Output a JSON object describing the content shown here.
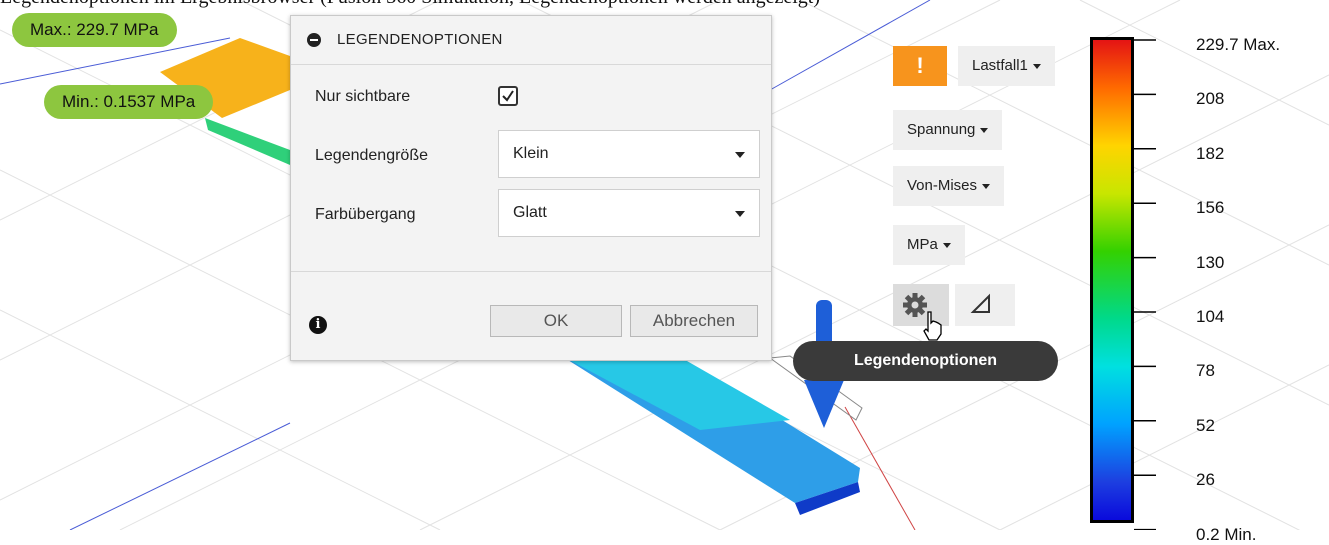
{
  "caption": "Legendenoptionen im Ergebnisbrowser (Fusion 360 Simulation, Legendenoptionen werden angezeigt)",
  "result_tags": {
    "max": "Max.: 229.7 MPa",
    "min": "Min.: 0.1537 MPa"
  },
  "dialog": {
    "title": "LEGENDENOPTIONEN",
    "rows": {
      "visible_only": {
        "label": "Nur sichtbare",
        "checked": true
      },
      "legend_size": {
        "label": "Legendengröße",
        "value": "Klein"
      },
      "color_transition": {
        "label": "Farbübergang",
        "value": "Glatt"
      }
    },
    "ok_label": "OK",
    "cancel_label": "Abbrechen"
  },
  "controls": {
    "warning": "!",
    "load_case": "Lastfall1",
    "result_type": "Spannung",
    "stress_type": "Von-Mises",
    "unit": "MPa",
    "tooltip": "Legendenoptionen"
  },
  "legend": {
    "ticks": [
      "229.7 Max.",
      "208",
      "182",
      "156",
      "130",
      "104",
      "78",
      "52",
      "26",
      "0.2 Min."
    ],
    "gradient_top_color": "#e41414",
    "gradient_bottom_color": "#0a0adc"
  },
  "colors": {
    "tag_green": "#8dc63f",
    "warning_orange": "#f7941d",
    "tooltip_bg": "#3a3a3a"
  }
}
